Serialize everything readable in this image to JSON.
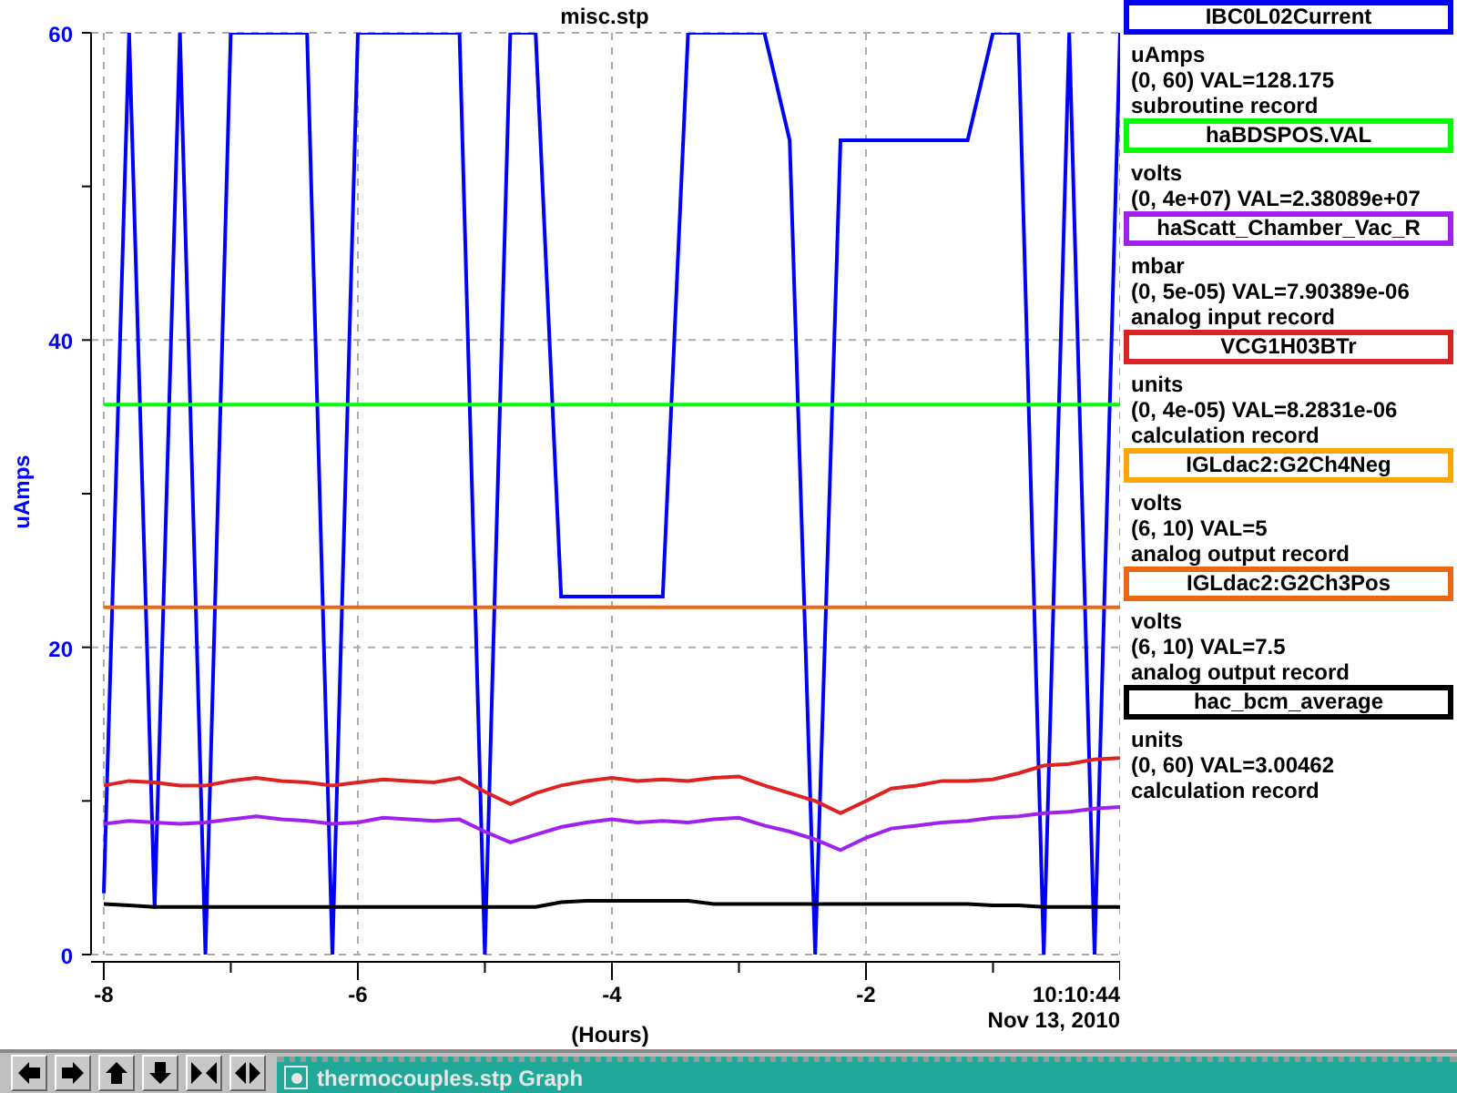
{
  "chart": {
    "end_time": "10:10:44",
    "end_date": "Nov 13, 2010",
    "chart_data": {
      "type": "line",
      "grid": true,
      "title": "misc.stp",
      "xlabel": "(Hours)",
      "ylabel": "uAmps",
      "xlim": [
        -8.1,
        0
      ],
      "ylim": [
        0,
        60
      ],
      "xticks": [
        -8,
        -6,
        -4,
        -2
      ],
      "yticks": [
        0,
        20,
        40,
        60
      ],
      "x": [
        -8.0,
        -7.8,
        -7.6,
        -7.4,
        -7.2,
        -7.0,
        -6.8,
        -6.6,
        -6.4,
        -6.2,
        -6.0,
        -5.8,
        -5.6,
        -5.4,
        -5.2,
        -5.0,
        -4.8,
        -4.6,
        -4.4,
        -4.2,
        -4.0,
        -3.8,
        -3.6,
        -3.4,
        -3.2,
        -3.0,
        -2.8,
        -2.6,
        -2.4,
        -2.2,
        -2.0,
        -1.8,
        -1.6,
        -1.4,
        -1.2,
        -1.0,
        -0.8,
        -0.6,
        -0.4,
        -0.2,
        0.0
      ],
      "series": [
        {
          "color": "#0000ff",
          "values": [
            4,
            60,
            3,
            60,
            0,
            60,
            60,
            60,
            60,
            0,
            60,
            60,
            60,
            60,
            60,
            0,
            60,
            60,
            23.3,
            23.3,
            23.3,
            23.3,
            23.3,
            60,
            60,
            60,
            60,
            53,
            0,
            53,
            53,
            53,
            53,
            53,
            53,
            60,
            60,
            0,
            60,
            0,
            60
          ]
        },
        {
          "color": "#00ff00",
          "values": [
            35.8,
            35.8,
            35.8,
            35.8,
            35.8,
            35.8,
            35.8,
            35.8,
            35.8,
            35.8,
            35.8,
            35.8,
            35.8,
            35.8,
            35.8,
            35.8,
            35.8,
            35.8,
            35.8,
            35.8,
            35.8,
            35.8,
            35.8,
            35.8,
            35.8,
            35.8,
            35.8,
            35.8,
            35.8,
            35.8,
            35.8,
            35.8,
            35.8,
            35.8,
            35.8,
            35.8,
            35.8,
            35.8,
            35.8,
            35.8,
            35.8
          ]
        },
        {
          "color": "#a020f0",
          "values": [
            8.5,
            8.7,
            8.6,
            8.5,
            8.6,
            8.8,
            9.0,
            8.8,
            8.7,
            8.5,
            8.6,
            8.9,
            8.8,
            8.7,
            8.8,
            8.0,
            7.3,
            7.8,
            8.3,
            8.6,
            8.8,
            8.6,
            8.7,
            8.6,
            8.8,
            8.9,
            8.4,
            8.0,
            7.5,
            6.8,
            7.6,
            8.2,
            8.4,
            8.6,
            8.7,
            8.9,
            9.0,
            9.2,
            9.3,
            9.5,
            9.6
          ]
        },
        {
          "color": "#dd2222",
          "values": [
            11.0,
            11.3,
            11.2,
            11.0,
            11.0,
            11.3,
            11.5,
            11.3,
            11.2,
            11.0,
            11.2,
            11.4,
            11.3,
            11.2,
            11.5,
            10.6,
            9.8,
            10.5,
            11.0,
            11.3,
            11.5,
            11.3,
            11.4,
            11.3,
            11.5,
            11.6,
            11.0,
            10.5,
            10.0,
            9.2,
            10.0,
            10.8,
            11.0,
            11.3,
            11.3,
            11.4,
            11.8,
            12.3,
            12.4,
            12.7,
            12.8
          ]
        },
        {
          "color": "#ee6611",
          "values": [
            22.6,
            22.6,
            22.6,
            22.6,
            22.6,
            22.6,
            22.6,
            22.6,
            22.6,
            22.6,
            22.6,
            22.6,
            22.6,
            22.6,
            22.6,
            22.6,
            22.6,
            22.6,
            22.6,
            22.6,
            22.6,
            22.6,
            22.6,
            22.6,
            22.6,
            22.6,
            22.6,
            22.6,
            22.6,
            22.6,
            22.6,
            22.6,
            22.6,
            22.6,
            22.6,
            22.6,
            22.6,
            22.6,
            22.6,
            22.6,
            22.6
          ]
        },
        {
          "color": "#000000",
          "values": [
            3.3,
            3.2,
            3.1,
            3.1,
            3.1,
            3.1,
            3.1,
            3.1,
            3.1,
            3.1,
            3.1,
            3.1,
            3.1,
            3.1,
            3.1,
            3.1,
            3.1,
            3.1,
            3.4,
            3.5,
            3.5,
            3.5,
            3.5,
            3.5,
            3.3,
            3.3,
            3.3,
            3.3,
            3.3,
            3.3,
            3.3,
            3.3,
            3.3,
            3.3,
            3.3,
            3.2,
            3.2,
            3.1,
            3.1,
            3.1,
            3.1
          ]
        }
      ]
    }
  },
  "legend": [
    {
      "name": "IBC0L02Current",
      "color": "#0000ff",
      "units": "uAmps",
      "range_value": "(0, 60) VAL=128.175",
      "record_type": "subroutine record"
    },
    {
      "name": "haBDSPOS.VAL",
      "color": "#00ff00",
      "units": "volts",
      "range_value": "(0, 4e+07) VAL=2.38089e+07"
    },
    {
      "name": "haScatt_Chamber_Vac_R",
      "color": "#a020f0",
      "units": "mbar",
      "range_value": "(0, 5e-05) VAL=7.90389e-06",
      "record_type": "analog input record"
    },
    {
      "name": "VCG1H03BTr",
      "color": "#dd2222",
      "units": "units",
      "range_value": "(0, 4e-05) VAL=8.2831e-06",
      "record_type": "calculation record"
    },
    {
      "name": "IGLdac2:G2Ch4Neg",
      "color": "#ffa500",
      "units": "volts",
      "range_value": "(6, 10) VAL=5",
      "record_type": "analog output record"
    },
    {
      "name": "IGLdac2:G2Ch3Pos",
      "color": "#ee6611",
      "units": "volts",
      "range_value": "(6, 10) VAL=7.5",
      "record_type": "analog output record"
    },
    {
      "name": "hac_bcm_average",
      "color": "#000000",
      "units": "units",
      "range_value": "(0, 60) VAL=3.00462",
      "record_type": "calculation record"
    }
  ],
  "taskbar": {
    "title": "thermocouples.stp Graph"
  }
}
